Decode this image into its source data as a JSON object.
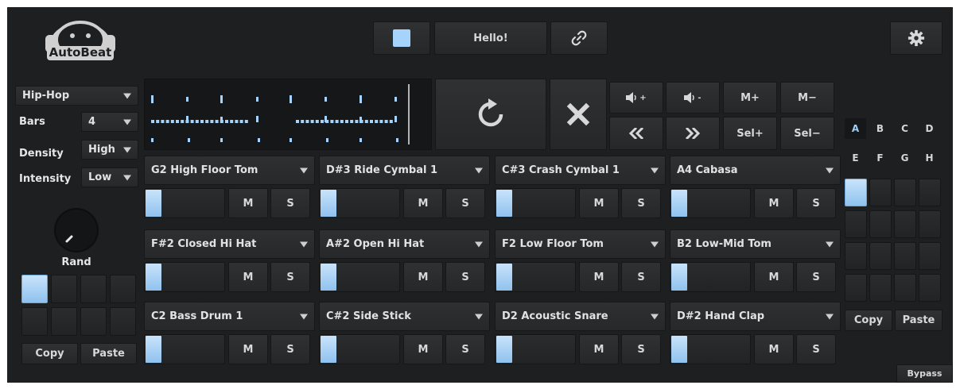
{
  "app": {
    "name": "AutoBeat"
  },
  "top": {
    "message": "Hello!"
  },
  "left": {
    "style_value": "Hip-Hop",
    "params": [
      {
        "label": "Bars",
        "value": "4"
      },
      {
        "label": "Density",
        "value": "High"
      },
      {
        "label": "Intensity",
        "value": "Low"
      }
    ],
    "knob_label": "Rand",
    "copy": "Copy",
    "paste": "Paste",
    "slots_active": [
      true,
      false,
      false,
      false,
      false,
      false,
      false,
      false
    ]
  },
  "transport": {
    "vol_up": "+",
    "vol_down": "-",
    "m_plus": "M+",
    "m_minus": "M−",
    "sel_plus": "Sel+",
    "sel_minus": "Sel−"
  },
  "tracks": [
    {
      "name": "G2 High Floor Tom",
      "mute": "M",
      "solo": "S",
      "level": 0.2
    },
    {
      "name": "D#3 Ride Cymbal 1",
      "mute": "M",
      "solo": "S",
      "level": 0.2
    },
    {
      "name": "C#3 Crash Cymbal 1",
      "mute": "M",
      "solo": "S",
      "level": 0.2
    },
    {
      "name": "A4 Cabasa",
      "mute": "M",
      "solo": "S",
      "level": 0.2
    },
    {
      "name": "F#2 Closed Hi Hat",
      "mute": "M",
      "solo": "S",
      "level": 0.2
    },
    {
      "name": "A#2 Open Hi Hat",
      "mute": "M",
      "solo": "S",
      "level": 0.2
    },
    {
      "name": "F2 Low Floor Tom",
      "mute": "M",
      "solo": "S",
      "level": 0.2
    },
    {
      "name": "B2 Low-Mid Tom",
      "mute": "M",
      "solo": "S",
      "level": 0.2
    },
    {
      "name": "C2 Bass Drum 1",
      "mute": "M",
      "solo": "S",
      "level": 0.2
    },
    {
      "name": "C#2 Side Stick",
      "mute": "M",
      "solo": "S",
      "level": 0.2
    },
    {
      "name": "D2 Acoustic Snare",
      "mute": "M",
      "solo": "S",
      "level": 0.2
    },
    {
      "name": "D#2 Hand Clap",
      "mute": "M",
      "solo": "S",
      "level": 0.2
    }
  ],
  "right": {
    "letters": [
      "A",
      "B",
      "C",
      "D",
      "E",
      "F",
      "G",
      "H"
    ],
    "selected_letter": "A",
    "grid_active": [
      true,
      false,
      false,
      false,
      false,
      false,
      false,
      false,
      false,
      false,
      false,
      false,
      false,
      false,
      false,
      false
    ],
    "copy": "Copy",
    "paste": "Paste",
    "bypass": "Bypass"
  },
  "colors": {
    "accent": "#9fd0fb",
    "background": "#1e1f20"
  },
  "icons": [
    "robot-logo-icon",
    "stop-icon",
    "link-icon",
    "gear-icon",
    "chevron-down-icon",
    "reload-icon",
    "close-icon",
    "volume-up-icon",
    "volume-down-icon",
    "rewind-icon",
    "fast-forward-icon"
  ]
}
